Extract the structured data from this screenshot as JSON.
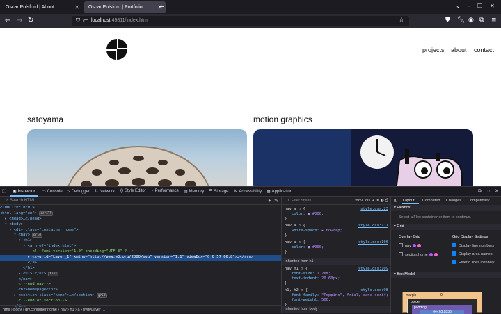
{
  "browser": {
    "tabs": [
      {
        "title": "Oscar Pulsford | About",
        "active": false
      },
      {
        "title": "Oscar Pulsford | Portfolio",
        "active": true
      }
    ],
    "new_tab_label": "+",
    "url_host": "localhost",
    "url_path": ":49811/index.html",
    "window_controls": {
      "minimize": "–",
      "maximize": "❐",
      "close": "✕"
    }
  },
  "site": {
    "nav": [
      "projects",
      "about",
      "contact"
    ],
    "sections": [
      "satoyama",
      "motion graphics"
    ]
  },
  "devtools": {
    "tabs": [
      "Inspector",
      "Console",
      "Debugger",
      "Network",
      "Style Editor",
      "Performance",
      "Memory",
      "Storage",
      "Accessibility",
      "Application"
    ],
    "search_placeholder": "Search HTML",
    "markup": [
      {
        "text": "<!DOCTYPE html>"
      },
      {
        "text": "<html lang=\"en\">",
        "badge": "scroll"
      },
      {
        "text": "  ▸ <head>…</head>"
      },
      {
        "text": "  ▾ <body>"
      },
      {
        "text": "    ▾ <div class=\"container home\">"
      },
      {
        "text": "      ▾ <nav>",
        "badge": "grid"
      },
      {
        "text": "        ▾ <h1>"
      },
      {
        "text": "          ▾ <a href=\"index.html\">"
      },
      {
        "text": "              <!--?xml version=\"1.0\" encoding=\"UTF-8\" ?-->"
      },
      {
        "text": "            ▸ <svg id=\"Layer_1\" xmlns=\"http://www.w3.org/2000/svg\" version=\"1.1\" viewBox=\"0 0 57 66.8\">…</svg>",
        "selected": true
      },
      {
        "text": "            </a>"
      },
      {
        "text": "          </h1>"
      },
      {
        "text": "        ▸ <ul>…</ul>",
        "badge": "flex"
      },
      {
        "text": "        </nav>"
      },
      {
        "text": "        <!--end nav-->"
      },
      {
        "text": "        <h2>homepage</h2>"
      },
      {
        "text": "      ▸ <section class=\"home\">…</section>",
        "badge": "grid"
      },
      {
        "text": "        <!--end of section-->"
      },
      {
        "text": "      </div>"
      }
    ],
    "breadcrumbs": "html  ›  body  ›  div.container.home  ›  nav  ›  h1  ›  a  ›  svg#Layer_1",
    "styles": {
      "filter_placeholder": "Filter Styles",
      "toolbar": ":hov  .cls  +  ☀  ◐  ⎙",
      "rules": [
        {
          "selector": "nav a ▫ {",
          "source": "style.css:23"
        },
        {
          "decl": "color: ■ #000;"
        },
        {
          "selector": "}",
          "source": ""
        },
        {
          "selector": "nav a ▫ {",
          "source": "style.css:111"
        },
        {
          "decl": "white-space: ▸ nowrap;"
        },
        {
          "selector": "}",
          "source": ""
        },
        {
          "selector": "nav a ▫ {",
          "source": "style.css:106"
        },
        {
          "decl": "color: ■ #000;"
        },
        {
          "selector": "}",
          "source": ""
        }
      ],
      "inherited_h1": "Inherited from h1",
      "h1_rules": [
        {
          "selector": "nav h1 ▫ {",
          "source": "style.css:109"
        },
        {
          "decl": "font-size: 1.2em;"
        },
        {
          "decl": "text-indent: 20.60px;"
        },
        {
          "selector": "}",
          "source": ""
        },
        {
          "selector": "h1, h2 ▫ {",
          "source": "style.css:98"
        },
        {
          "decl": "font-family: \"Poppins\", Arial, sans-serif;"
        },
        {
          "decl": "font-weight: 500;"
        },
        {
          "selector": "}",
          "source": ""
        }
      ],
      "inherited_body": "Inherited from body"
    },
    "layout_tabs": [
      "Layout",
      "Computed",
      "Changes",
      "Compatibility"
    ],
    "flexbox_header": "Flexbox",
    "flexbox_hint": "Select a Flex container or item to continue.",
    "grid_header": "Grid",
    "overlay_grid": "Overlay Grid",
    "grid_items": [
      "nav",
      "section.home"
    ],
    "grid_display_settings": "Grid Display Settings",
    "grid_options": [
      "Display line numbers",
      "Display area names",
      "Extend lines infinitely"
    ],
    "box_model_header": "Box Model",
    "box_model": {
      "margin": "margin",
      "border": "border",
      "padding": "padding",
      "content": "64×63.2833",
      "zero": "0"
    },
    "colors": {
      "accent": "#75bfff",
      "selection": "#204e8a",
      "grid_dot_1": "#b15dff",
      "grid_dot_2": "#ff65d1"
    }
  }
}
